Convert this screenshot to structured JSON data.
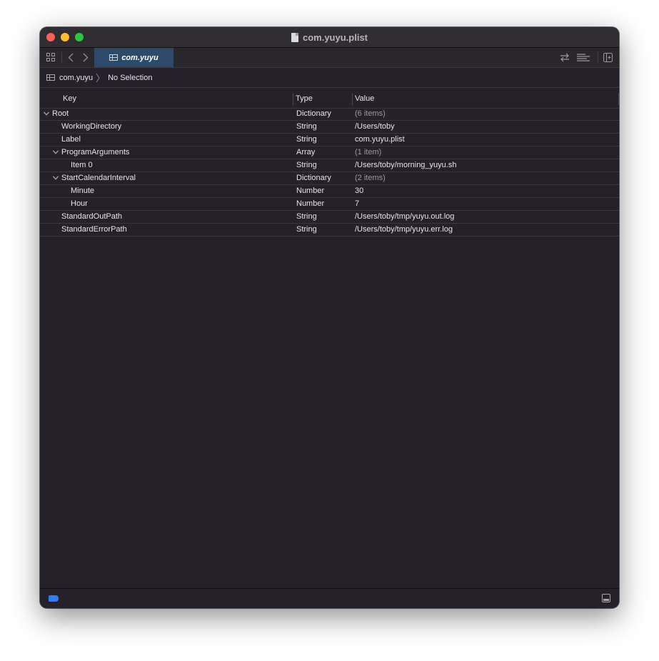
{
  "window": {
    "title": "com.yuyu.plist"
  },
  "toolbar": {
    "tab_label": "com.yuyu",
    "back_icon": "chevron-left-icon",
    "forward_icon": "chevron-right-icon"
  },
  "pathbar": {
    "file": "com.yuyu",
    "selection": "No Selection"
  },
  "table": {
    "columns": {
      "key": "Key",
      "type": "Type",
      "value": "Value"
    },
    "rows": [
      {
        "key": "Root",
        "type": "Dictionary",
        "value": "(6 items)",
        "depth": 0,
        "expanded": true
      },
      {
        "key": "WorkingDirectory",
        "type": "String",
        "value": "/Users/toby",
        "depth": 1
      },
      {
        "key": "Label",
        "type": "String",
        "value": "com.yuyu.plist",
        "depth": 1
      },
      {
        "key": "ProgramArguments",
        "type": "Array",
        "value": "(1 item)",
        "depth": 1,
        "expanded": true
      },
      {
        "key": "Item 0",
        "type": "String",
        "value": "/Users/toby/morning_yuyu.sh",
        "depth": 2
      },
      {
        "key": "StartCalendarInterval",
        "type": "Dictionary",
        "value": "(2 items)",
        "depth": 1,
        "expanded": true
      },
      {
        "key": "Minute",
        "type": "Number",
        "value": "30",
        "depth": 2
      },
      {
        "key": "Hour",
        "type": "Number",
        "value": "7",
        "depth": 2
      },
      {
        "key": "StandardOutPath",
        "type": "String",
        "value": "/Users/toby/tmp/yuyu.out.log",
        "depth": 1
      },
      {
        "key": "StandardErrorPath",
        "type": "String",
        "value": "/Users/toby/tmp/yuyu.err.log",
        "depth": 1
      }
    ]
  },
  "colors": {
    "tab_active": "#2e4a6b",
    "status_tag": "#2f7cf6",
    "background": "#25212a"
  }
}
